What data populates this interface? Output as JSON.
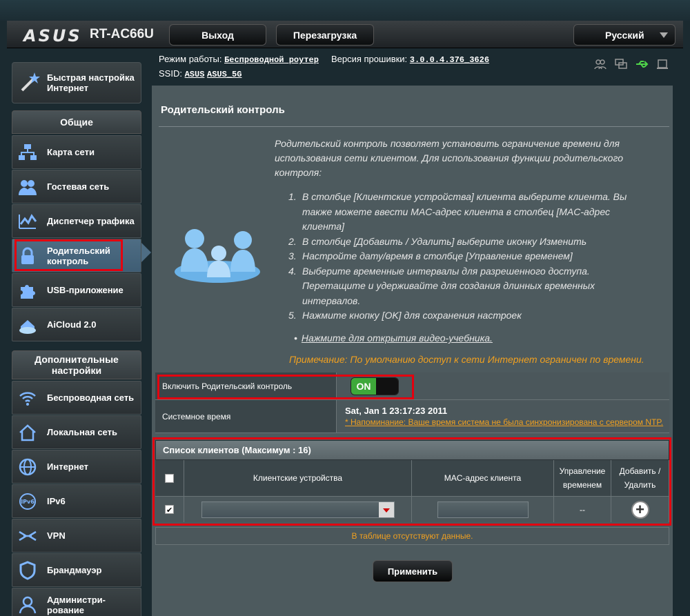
{
  "header": {
    "brand": "ASUS",
    "model": "RT-AC66U",
    "logout": "Выход",
    "reboot": "Перезагрузка",
    "language": "Русский"
  },
  "info": {
    "mode_label": "Режим работы:",
    "mode_value": "Беспроводной роутер",
    "fw_label": "Версия прошивки:",
    "fw_value": "3.0.0.4.376_3626",
    "ssid_label": "SSID:",
    "ssid_1": "ASUS",
    "ssid_2": "ASUS_5G"
  },
  "sidebar": {
    "quick_setup": "Быстрая настройка Интернет",
    "general_title": "Общие",
    "general": [
      {
        "label": "Карта сети",
        "icon": "network-map-icon"
      },
      {
        "label": "Гостевая сеть",
        "icon": "guest-network-icon"
      },
      {
        "label": "Диспетчер трафика",
        "icon": "traffic-manager-icon"
      },
      {
        "label": "Родительский контроль",
        "icon": "lock-icon"
      },
      {
        "label": "USB-приложение",
        "icon": "puzzle-icon"
      },
      {
        "label": "AiCloud 2.0",
        "icon": "cloud-house-icon"
      }
    ],
    "advanced_title": "Дополнительные настройки",
    "advanced": [
      {
        "label": "Беспроводная сеть",
        "icon": "wifi-icon"
      },
      {
        "label": "Локальная сеть",
        "icon": "home-icon"
      },
      {
        "label": "Интернет",
        "icon": "globe-icon"
      },
      {
        "label": "IPv6",
        "icon": "ipv6-icon"
      },
      {
        "label": "VPN",
        "icon": "vpn-icon"
      },
      {
        "label": "Брандмауэр",
        "icon": "shield-icon"
      },
      {
        "label": "Администри-рование",
        "icon": "admin-icon"
      }
    ]
  },
  "main": {
    "title": "Родительский контроль",
    "description": "Родительский контроль позволяет установить ограничение времени для использования сети клиентом. Для использования функции родительского контроля:",
    "steps": [
      {
        "n": "1.",
        "text": "В столбце [Клиентские устройства] клиента выберите клиента. Вы также можете ввести MAC-адрес клиента в столбец [MAC-адрес клиента]"
      },
      {
        "n": "2.",
        "text": "В столбце [Добавить / Удалить] выберите иконку Изменить"
      },
      {
        "n": "3.",
        "text": "Настройте дату/время в столбце [Управление временем]"
      },
      {
        "n": "4.",
        "text": "Выберите временные интервалы для разрешенного доступа. Перетащите и удерживайте для создания длинных временных интервалов."
      },
      {
        "n": "5.",
        "text": "Нажмите кнопку [OK] для сохранения настроек"
      }
    ],
    "video_bullet": "•",
    "video_link": "Нажмите для открытия видео-учебника.",
    "note": "Примечание: По умолчанию доступ к сети Интернет ограничен по времени.",
    "enable_label": "Включить Родительский контроль",
    "toggle_on": "ON",
    "time_label": "Системное время",
    "time_value": "Sat, Jan 1  23:17:23 2011",
    "time_warning": "* Напоминание: Ваше время система не была синхронизирована с сервером NTP.",
    "client_list_title": "Список клиентов (Максимум : 16)",
    "col_devices": "Клиентские устройства",
    "col_mac": "MAC-адрес клиента",
    "col_time": "Управление временем",
    "col_addremove": "Добавить / Удалить",
    "row_time_value": "--",
    "no_data": "В таблице отсутствуют данные.",
    "apply": "Применить"
  },
  "colors": {
    "accent_red": "#e4000f",
    "note_orange": "#f0a020",
    "toggle_green": "#3ea83a",
    "active_nav": "#4e6d84"
  }
}
